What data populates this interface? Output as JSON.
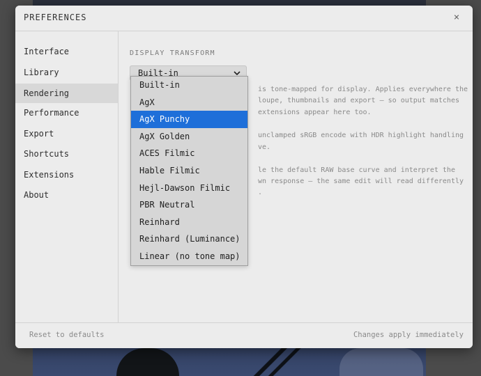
{
  "modal": {
    "title": "PREFERENCES",
    "close_icon": "×"
  },
  "sidebar": {
    "items": [
      {
        "label": "Interface",
        "active": false
      },
      {
        "label": "Library",
        "active": false
      },
      {
        "label": "Rendering",
        "active": true
      },
      {
        "label": "Performance",
        "active": false
      },
      {
        "label": "Export",
        "active": false
      },
      {
        "label": "Shortcuts",
        "active": false
      },
      {
        "label": "Extensions",
        "active": false
      },
      {
        "label": "About",
        "active": false
      }
    ]
  },
  "content": {
    "section_label": "DISPLAY TRANSFORM",
    "select": {
      "value": "Built-in",
      "icon": "chevron-down-icon"
    },
    "description": {
      "line1": "is tone-mapped for display. Applies everywhere the",
      "line2": "loupe, thumbnails and export — so output matches",
      "line3": "extensions appear here too.",
      "line4": "unclamped sRGB encode with HDR highlight handling",
      "line5": "ve.",
      "line6": "le the default RAW base curve and interpret the",
      "line7": "wn response — the same edit will read differently",
      "line8": "."
    }
  },
  "dropdown": {
    "options": [
      {
        "label": "Built-in",
        "highlighted": false
      },
      {
        "label": "AgX",
        "highlighted": false
      },
      {
        "label": "AgX Punchy",
        "highlighted": true
      },
      {
        "label": "AgX Golden",
        "highlighted": false
      },
      {
        "label": "ACES Filmic",
        "highlighted": false
      },
      {
        "label": "Hable Filmic",
        "highlighted": false
      },
      {
        "label": "Hejl-Dawson Filmic",
        "highlighted": false
      },
      {
        "label": "PBR Neutral",
        "highlighted": false
      },
      {
        "label": "Reinhard",
        "highlighted": false
      },
      {
        "label": "Reinhard (Luminance)",
        "highlighted": false
      },
      {
        "label": "Linear (no tone map)",
        "highlighted": false
      }
    ]
  },
  "footer": {
    "reset_label": "Reset to defaults",
    "note": "Changes apply immediately"
  },
  "colors": {
    "highlight": "#1e6fd9",
    "modal_bg": "#ececec",
    "active_nav": "#d8d8d8"
  }
}
